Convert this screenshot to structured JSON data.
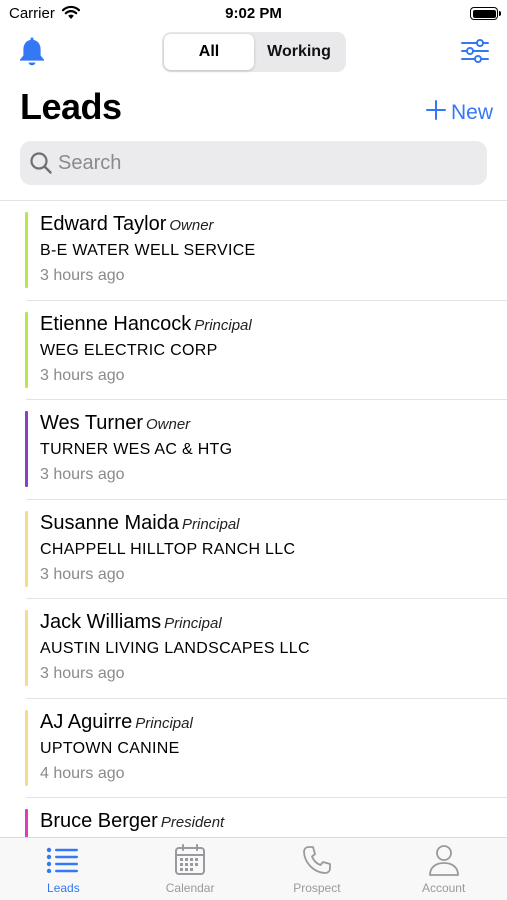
{
  "status_bar": {
    "carrier": "Carrier",
    "time": "9:02 PM"
  },
  "segments": {
    "all": "All",
    "working": "Working",
    "selected": "All"
  },
  "page": {
    "title": "Leads",
    "new_label": "New"
  },
  "search": {
    "placeholder": "Search",
    "value": ""
  },
  "colors": {
    "accent": "#3478f6"
  },
  "leads": [
    {
      "name": "Edward Taylor",
      "title": "Owner",
      "company": "B-E WATER WELL SERVICE",
      "time": "3 hours ago",
      "color": "#b6e84a"
    },
    {
      "name": "Etienne Hancock",
      "title": "Principal",
      "company": "WEG ELECTRIC CORP",
      "time": "3 hours ago",
      "color": "#b6e84a"
    },
    {
      "name": "Wes Turner",
      "title": "Owner",
      "company": "TURNER WES AC & HTG",
      "time": "3 hours ago",
      "color": "#8a3fc7"
    },
    {
      "name": "Susanne Maida",
      "title": "Principal",
      "company": "CHAPPELL HILLTOP RANCH LLC",
      "time": "3 hours ago",
      "color": "#f5dc8a"
    },
    {
      "name": "Jack Williams",
      "title": "Principal",
      "company": "AUSTIN LIVING LANDSCAPES LLC",
      "time": "3 hours ago",
      "color": "#f5dc8a"
    },
    {
      "name": "AJ Aguirre",
      "title": "Principal",
      "company": "UPTOWN CANINE",
      "time": "4 hours ago",
      "color": "#f5dc8a"
    },
    {
      "name": "Bruce Berger",
      "title": "President",
      "company": "",
      "time": "",
      "color": "#e03bb8"
    }
  ],
  "tabs": [
    {
      "label": "Leads",
      "icon": "list-icon",
      "active": true
    },
    {
      "label": "Calendar",
      "icon": "calendar-icon",
      "active": false
    },
    {
      "label": "Prospect",
      "icon": "phone-icon",
      "active": false
    },
    {
      "label": "Account",
      "icon": "person-icon",
      "active": false
    }
  ]
}
